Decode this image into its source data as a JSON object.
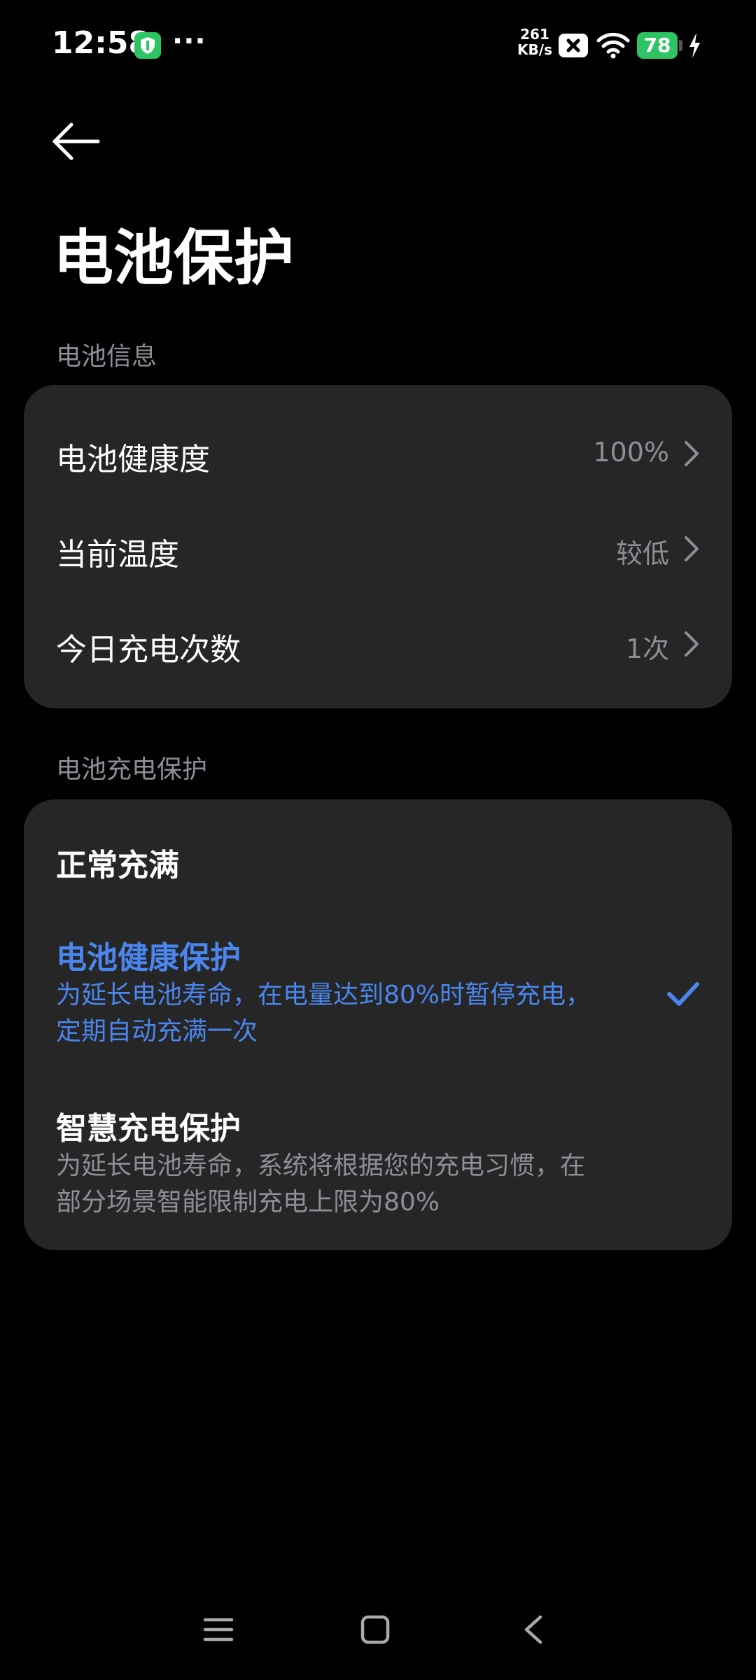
{
  "status_bar": {
    "time": "12:58",
    "more": "···",
    "net_speed_value": "261",
    "net_speed_unit": "KB/s",
    "battery_level": "78",
    "icons": [
      "shield-icon",
      "no-sim-icon",
      "wifi-icon",
      "battery-icon",
      "charging-bolt-icon"
    ],
    "colors": {
      "battery": "#2fc463",
      "shield": "#2fc463"
    }
  },
  "header": {
    "title": "电池保护"
  },
  "battery_info": {
    "section_label": "电池信息",
    "rows": [
      {
        "label": "电池健康度",
        "value": "100%"
      },
      {
        "label": "当前温度",
        "value": "较低"
      },
      {
        "label": "今日充电次数",
        "value": "1次"
      }
    ]
  },
  "charge_protection": {
    "section_label": "电池充电保护",
    "options": [
      {
        "title": "正常充满",
        "desc_line1": "",
        "desc_line2": "",
        "selected": false
      },
      {
        "title": "电池健康保护",
        "desc_line1": "为延长电池寿命，在电量达到80%时暂停充电，",
        "desc_line2": "定期自动充满一次",
        "selected": true
      },
      {
        "title": "智慧充电保护",
        "desc_line1": "为延长电池寿命，系统将根据您的充电习惯，在",
        "desc_line2": "部分场景智能限制充电上限为80%",
        "selected": false
      }
    ],
    "accent_color": "#4b86ee"
  },
  "nav_bar": {
    "icons": [
      "menu-icon",
      "home-icon",
      "back-icon"
    ]
  }
}
